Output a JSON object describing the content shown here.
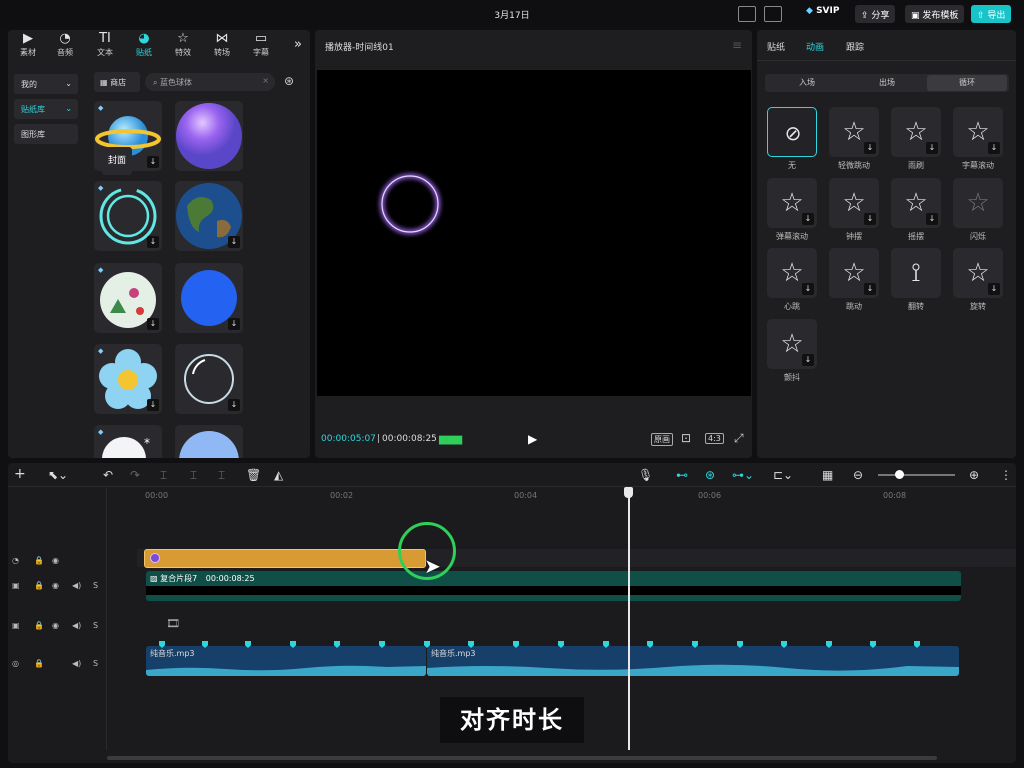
{
  "topbar": {
    "date": "3月17日",
    "svip": "SVIP",
    "share": "分享",
    "publish_template": "发布模板",
    "export": "导出"
  },
  "media_tabs": [
    {
      "label": "素材",
      "icon": "media-icon"
    },
    {
      "label": "音频",
      "icon": "audio-icon"
    },
    {
      "label": "文本",
      "icon": "text-icon"
    },
    {
      "label": "贴纸",
      "icon": "sticker-icon"
    },
    {
      "label": "特效",
      "icon": "effects-icon"
    },
    {
      "label": "转场",
      "icon": "transition-icon"
    },
    {
      "label": "字幕",
      "icon": "subtitle-icon"
    }
  ],
  "sidebar": {
    "items": [
      "我的",
      "贴纸库",
      "图形库"
    ]
  },
  "library": {
    "shop": "商店",
    "search_value": "蓝色球体"
  },
  "player": {
    "title": "播放器-时间线01",
    "current_time": "00:00:05:07",
    "total_time": "00:00:08:25",
    "original_label": "原画",
    "ratio": "4:3"
  },
  "effects": {
    "tabs": [
      "贴纸",
      "动画",
      "跟踪"
    ],
    "subtabs": [
      "入场",
      "出场",
      "循环"
    ],
    "items": [
      "无",
      "轻微跳动",
      "雨刷",
      "字幕滚动",
      "弹幕滚动",
      "钟摆",
      "摇摆",
      "闪烁",
      "心跳",
      "跳动",
      "翻转",
      "旋转",
      "颤抖"
    ]
  },
  "timeline": {
    "ruler": [
      "00:00",
      "00:02",
      "00:04",
      "00:06",
      "00:08"
    ],
    "compound_clip": "复合片段7",
    "compound_duration": "00:00:08:25",
    "cover": "封面",
    "audio_clips": [
      "纯音乐.mp3",
      "纯音乐.mp3"
    ]
  },
  "caption": "对齐时长",
  "colors": {
    "accent": "#2fd6dc",
    "sticker_clip": "#d89a32",
    "video_clip": "#0f4f47",
    "audio_clip": "#163f6a",
    "focus_ring": "#2fcf5a"
  }
}
